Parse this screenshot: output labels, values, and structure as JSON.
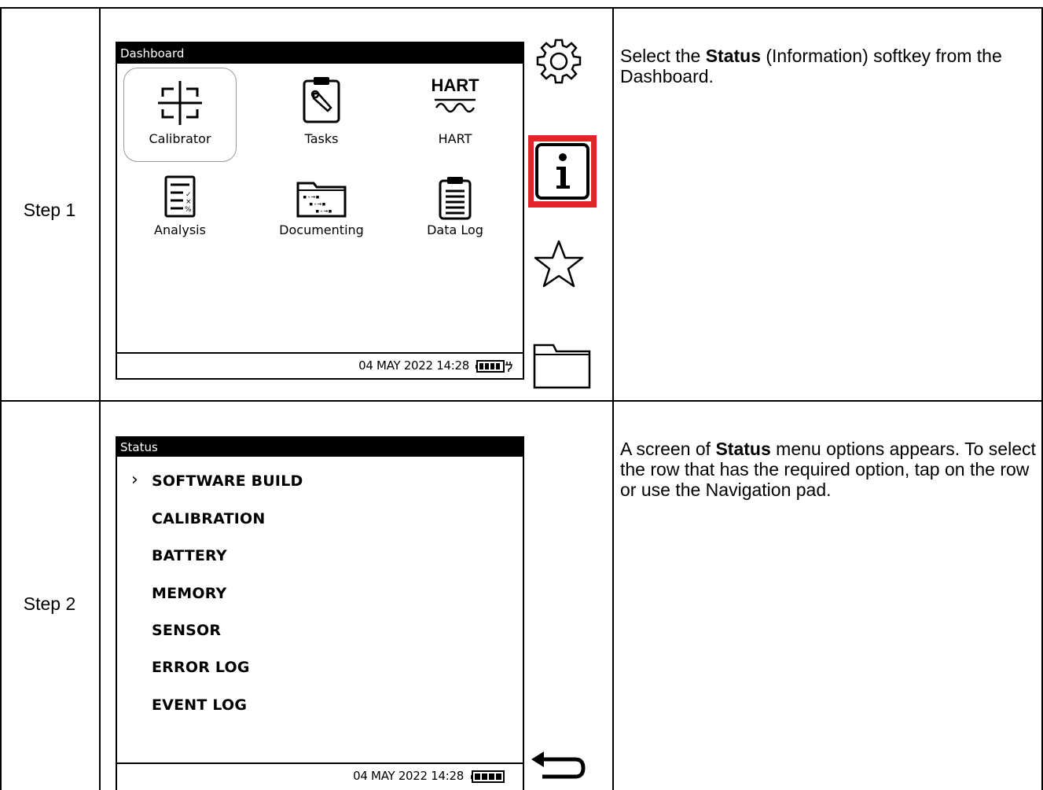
{
  "steps": [
    {
      "label": "Step 1",
      "screen": {
        "title": "Dashboard",
        "apps": [
          {
            "label": "Calibrator",
            "icon": "calibrator-icon",
            "selected": true
          },
          {
            "label": "Tasks",
            "icon": "tasks-icon"
          },
          {
            "label": "HART",
            "icon": "hart-icon",
            "icon_text": "HART"
          },
          {
            "label": "Analysis",
            "icon": "analysis-icon"
          },
          {
            "label": "Documenting",
            "icon": "documenting-icon"
          },
          {
            "label": "Data Log",
            "icon": "data-log-icon"
          }
        ],
        "datetime": "04 MAY 2022 14:28",
        "battery": "battery-charging-icon"
      },
      "softkeys": [
        "settings-gear-icon",
        "info-icon",
        "favorites-star-icon",
        "folder-icon"
      ],
      "highlight_color": "#e3232a",
      "description": {
        "pre": "Select the ",
        "bold": "Status",
        "post": " (Information) softkey from the Dashboard."
      }
    },
    {
      "label": "Step 2",
      "screen": {
        "title": "Status",
        "menu": [
          "SOFTWARE BUILD",
          "CALIBRATION",
          "BATTERY",
          "MEMORY",
          "SENSOR",
          "ERROR LOG",
          "EVENT LOG"
        ],
        "cursor": "›",
        "datetime": "04 MAY 2022 14:28",
        "battery": "battery-full-icon"
      },
      "softkeys": [
        "back-arrow-icon"
      ],
      "description": {
        "pre": "A screen of ",
        "bold": "Status",
        "post": " menu options appears. To select the row that has the required option, tap on the row or use the Navigation pad."
      }
    }
  ]
}
